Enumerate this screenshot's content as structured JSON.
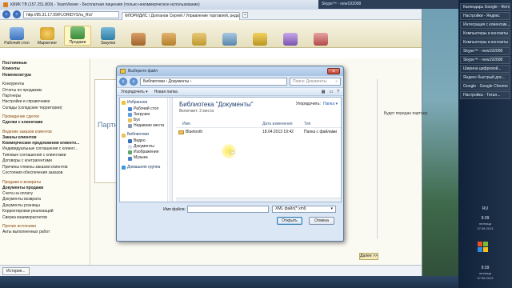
{
  "browser": {
    "title": "КИИК ТВ (157.251.800) - TeamViewer - Бесплатная лицензия (только некоммерческое использование)",
    "url": "http://95.31.17.59/FLORIDYS/ru_RU/",
    "tab": "ФЛОРИДИС / Долганов Сергей / Управление торговлей, редакция 11.1 (1С:Предприятие)"
  },
  "toolbar": {
    "items": [
      "Рабочий стол",
      "Маркетинг",
      "Продажи",
      "Закупки",
      "",
      "",
      "",
      "",
      "",
      "",
      ""
    ]
  },
  "sidebar": {
    "top": [
      "Постоянные",
      "Клиенты",
      "Номенклатура"
    ],
    "group1": [
      "Конкуренты",
      "Отчеты по продажам",
      "Партнеры",
      "Настройки и справочники",
      "Склады (складские территории)"
    ],
    "group2_title": "Проведение сделок",
    "group2": [
      "Сделки с клиентами"
    ],
    "group3_title": "Ведение заказов клиентов",
    "group3": [
      "Заказы клиентов",
      "Коммерческие предложения клиенто...",
      "Индивидуальные соглашения с клиент...",
      "Типовые соглашения с клиентами",
      "Договоры с контрагентами",
      "Причины отмены заказов клиентов",
      "Состояния обеспечения заказов"
    ],
    "group4_title": "Продажи и возвраты",
    "group4": [
      "Документы продажи",
      "Счета на оплату",
      "Документы возврата",
      "Документы розницы",
      "Корректировки реализаций",
      "Сверка взаиморасчетов"
    ],
    "group5_title": "Прочие источники",
    "group5": [
      "Акты выполненных работ"
    ]
  },
  "content": {
    "partial_title": "Партнер",
    "more_button": "Далее >>"
  },
  "status": {
    "history": "История..."
  },
  "skype": {
    "title": "Skype™ - new192008"
  },
  "taskpanel": {
    "items": [
      "Календарь Google - Фото...",
      "Настройки - Яндекс",
      "Интеграция с клиентам...",
      "Компьютеры и контакты",
      "Компьютеры и контакты",
      "Skype™ - new192008",
      "Skype™ - new192008",
      "Ширина цифровой...",
      "Яндекс-быстрый дос...",
      "Google - Google Chrome",
      "Настройка - Тотал..."
    ],
    "lang": "RU",
    "time1": "9:39",
    "day1": "пятница",
    "date1": "07.06.2013",
    "time2": "9:39",
    "day2": "пятница",
    "date2": "07.06.2013"
  },
  "right_strip": [
    "Будет передан партнер"
  ],
  "dialog": {
    "title": "Выберите файл",
    "address": "Библиотеки › Документы ›",
    "search_placeholder": "Поиск: Документы",
    "cmd_organize": "Упорядочить ▾",
    "cmd_new_folder": "Новая папка",
    "library_title": "Библиотека \"Документы\"",
    "library_sub": "Включает: 2 места",
    "arrange_label": "Упорядочить:",
    "arrange_value": "Папка ▾",
    "columns": [
      "Имя",
      "Дата изменения",
      "Тип"
    ],
    "file": {
      "name": "Bluetooth",
      "date": "18.04.2013 19:42",
      "type": "Папка с файлами"
    },
    "tree": {
      "favorites_title": "Избранное",
      "favorites": [
        "Рабочий стол",
        "Загрузки",
        "Бух",
        "Недавние места"
      ],
      "libraries_title": "Библиотеки",
      "libraries": [
        "Видео",
        "Документы",
        "Изображения",
        "Музыка"
      ],
      "homegroup": "Домашняя группа"
    },
    "filename_label": "Имя файла:",
    "filename_value": "",
    "filetype": "XML файл(*.xml)",
    "open_button": "Открыть",
    "cancel_button": "Отмена"
  }
}
